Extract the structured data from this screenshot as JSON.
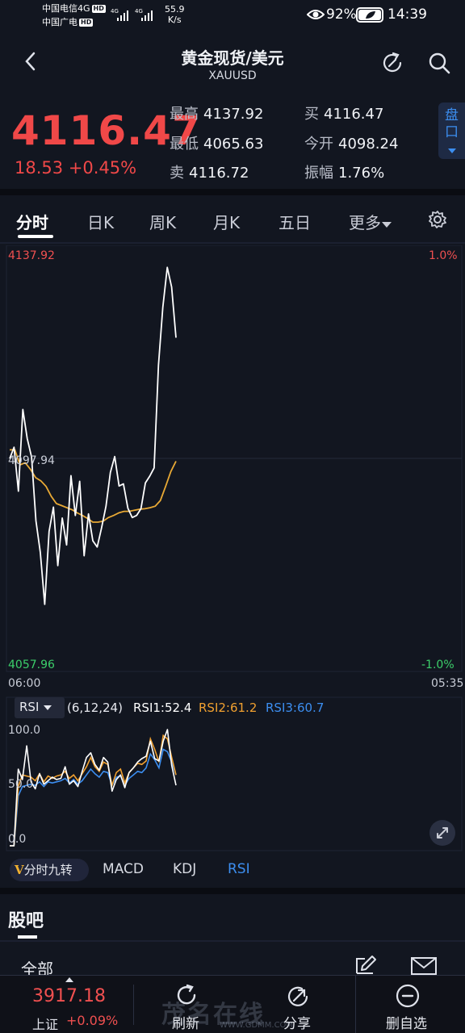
{
  "status_bar": {
    "carrier1": "中国电信4G",
    "carrier2": "中国广电",
    "hd": "HD",
    "net1": "4G",
    "net2": "4G",
    "speed_value": "55.9",
    "speed_unit": "K/s",
    "battery": "92%",
    "time": "14:39"
  },
  "header": {
    "title": "黄金现货/美元",
    "symbol": "XAUUSD"
  },
  "quote": {
    "price": "4116.47",
    "change": "18.53",
    "change_pct": "+0.45%",
    "high_label": "最高",
    "high_value": "4137.92",
    "low_label": "最低",
    "low_value": "4065.63",
    "sell_label": "卖",
    "sell_value": "4116.72",
    "buy_label": "买",
    "buy_value": "4116.47",
    "open_label": "今开",
    "open_value": "4098.24",
    "amp_label": "振幅",
    "amp_value": "1.76%",
    "pankou": "盘口"
  },
  "tabs": [
    "分时",
    "日K",
    "周K",
    "月K",
    "五日",
    "更多"
  ],
  "chart": {
    "y_top": "4137.92",
    "y_mid": "4097.94",
    "y_bottom": "4057.96",
    "pct_top": "1.0%",
    "pct_bottom": "-1.0%",
    "time_start": "06:00",
    "time_end": "05:35"
  },
  "rsi": {
    "select_label": "RSI",
    "params": "(6,12,24)",
    "rsi1": "RSI1:52.4",
    "rsi2": "RSI2:61.2",
    "rsi3": "RSI3:60.7",
    "axis_100": "100.0",
    "axis_50": "50.0",
    "axis_0": "0.0"
  },
  "indicator_tabs": {
    "jiuzhuan": "分时九转",
    "macd": "MACD",
    "kdj": "KDJ",
    "rsi": "RSI"
  },
  "guba": {
    "title": "股吧",
    "filter": "全部"
  },
  "bottom_bar": {
    "index_price": "3917.18",
    "index_name": "上证",
    "index_change": "+0.09%",
    "refresh": "刷新",
    "share": "分享",
    "remove": "删自选",
    "watermark": "茂名在线",
    "watermark_url": "WWW.GDMM.COM"
  },
  "colors": {
    "up": "#f04848",
    "down": "#3ccf6a",
    "price_line": "#ffffff",
    "avg_line": "#e8a935",
    "rsi1": "#ffffff",
    "rsi2": "#f0a030",
    "rsi3": "#3c8ef0",
    "accent": "#3c8ef0"
  },
  "chart_data": {
    "type": "line",
    "x_range": [
      "06:00",
      "05:35"
    ],
    "ylim": [
      4057.96,
      4137.92
    ],
    "series": [
      {
        "name": "price",
        "values": [
          4097.9,
          4100.1,
          4091.6,
          4107.4,
          4101.8,
          4098.2,
          4085.9,
          4079.8,
          4069.7,
          4083.8,
          4088.5,
          4077.2,
          4086.4,
          4081.2,
          4094.6,
          4086.9,
          4093.5,
          4079.1,
          4087.2,
          4082.0,
          4080.8,
          4084.5,
          4088.7,
          4095.2,
          4098.3,
          4092.6,
          4093.0,
          4088.3,
          4086.5,
          4086.9,
          4088.2,
          4093.2,
          4094.5,
          4096.1,
          4116.0,
          4127.2,
          4134.9,
          4131.1,
          4121.3
        ]
      },
      {
        "name": "avg",
        "values": [
          4099.6,
          4099.6,
          4096.7,
          4097.1,
          4095.8,
          4094.2,
          4093.6,
          4092.5,
          4090.6,
          4089.2,
          4088.8,
          4088.4,
          4088.0,
          4087.4,
          4086.9,
          4086.3,
          4085.6,
          4085.6,
          4085.8,
          4086.5,
          4086.9,
          4087.4,
          4087.7,
          4087.7,
          4087.9,
          4088.1,
          4088.2,
          4088.4,
          4088.7,
          4089.8,
          4092.5,
          4095.4,
          4097.4
        ]
      },
      {
        "name": "RSI1",
        "values": [
          0,
          0,
          66,
          57,
          86,
          55,
          49,
          62,
          53,
          56,
          59,
          57,
          58,
          68,
          53,
          56,
          51,
          64,
          76,
          80,
          70,
          65,
          76,
          72,
          47,
          57,
          61,
          50,
          63,
          67,
          72,
          75,
          77,
          90,
          75,
          73,
          90,
          100,
          69,
          52
        ]
      },
      {
        "name": "RSI2",
        "values": [
          0,
          0,
          51,
          61,
          60,
          59,
          56,
          62,
          55,
          60,
          58,
          60,
          61,
          64,
          58,
          61,
          56,
          62,
          68,
          76,
          68,
          64,
          72,
          70,
          52,
          63,
          66,
          54,
          63,
          67,
          71,
          70,
          73,
          92,
          83,
          72,
          95,
          92,
          76,
          61
        ]
      },
      {
        "name": "RSI3",
        "values": [
          0,
          0,
          43,
          51,
          52,
          53,
          52,
          55,
          51,
          55,
          54,
          55,
          56,
          58,
          54,
          57,
          53,
          56,
          61,
          66,
          62,
          59,
          64,
          63,
          52,
          59,
          60,
          52,
          58,
          61,
          64,
          63,
          67,
          79,
          74,
          67,
          83,
          81,
          72,
          61
        ]
      }
    ]
  }
}
